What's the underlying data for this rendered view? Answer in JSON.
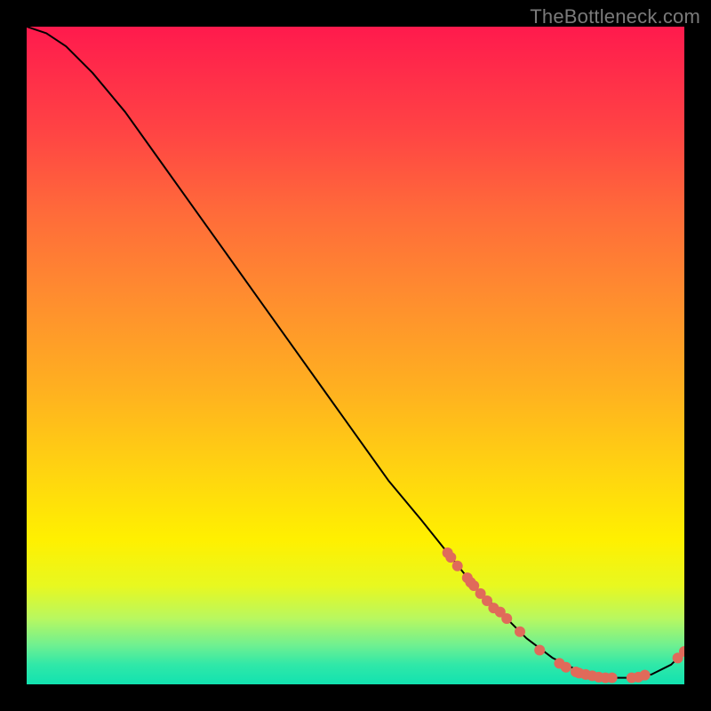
{
  "watermark": "TheBottleneck.com",
  "chart_data": {
    "type": "line",
    "title": "",
    "xlabel": "",
    "ylabel": "",
    "xlim": [
      0,
      100
    ],
    "ylim": [
      0,
      100
    ],
    "grid": false,
    "legend": false,
    "background_gradient": {
      "stops": [
        {
          "pct": 0,
          "color": "#ff1a4d"
        },
        {
          "pct": 50,
          "color": "#ffb020"
        },
        {
          "pct": 80,
          "color": "#fff000"
        },
        {
          "pct": 100,
          "color": "#12e2b0"
        }
      ]
    },
    "series": [
      {
        "name": "bottleneck-curve",
        "color": "#000000",
        "x": [
          0,
          3,
          6,
          10,
          15,
          20,
          25,
          30,
          35,
          40,
          45,
          50,
          55,
          60,
          64,
          68,
          72,
          76,
          80,
          84,
          88,
          92,
          95,
          98,
          100
        ],
        "y": [
          100,
          99,
          97,
          93,
          87,
          80,
          73,
          66,
          59,
          52,
          45,
          38,
          31,
          25,
          20,
          15,
          11,
          7,
          4,
          2,
          1,
          1,
          1.5,
          3,
          5
        ]
      }
    ],
    "scatter": [
      {
        "name": "highlight-dots",
        "color": "#e06a5a",
        "radius_px": 6,
        "points": [
          {
            "x": 64.0,
            "y": 20.0
          },
          {
            "x": 64.5,
            "y": 19.3
          },
          {
            "x": 65.5,
            "y": 18.0
          },
          {
            "x": 67.0,
            "y": 16.2
          },
          {
            "x": 67.5,
            "y": 15.5
          },
          {
            "x": 68.0,
            "y": 15.0
          },
          {
            "x": 69.0,
            "y": 13.8
          },
          {
            "x": 70.0,
            "y": 12.7
          },
          {
            "x": 71.0,
            "y": 11.6
          },
          {
            "x": 72.0,
            "y": 11.0
          },
          {
            "x": 73.0,
            "y": 10.0
          },
          {
            "x": 75.0,
            "y": 8.0
          },
          {
            "x": 78.0,
            "y": 5.2
          },
          {
            "x": 81.0,
            "y": 3.2
          },
          {
            "x": 82.0,
            "y": 2.6
          },
          {
            "x": 83.5,
            "y": 1.9
          },
          {
            "x": 84.0,
            "y": 1.7
          },
          {
            "x": 85.0,
            "y": 1.5
          },
          {
            "x": 86.0,
            "y": 1.3
          },
          {
            "x": 87.0,
            "y": 1.1
          },
          {
            "x": 88.0,
            "y": 1.0
          },
          {
            "x": 89.0,
            "y": 1.0
          },
          {
            "x": 92.0,
            "y": 1.0
          },
          {
            "x": 93.0,
            "y": 1.1
          },
          {
            "x": 94.0,
            "y": 1.4
          },
          {
            "x": 99.0,
            "y": 4.0
          },
          {
            "x": 100.0,
            "y": 5.0
          }
        ]
      }
    ]
  }
}
